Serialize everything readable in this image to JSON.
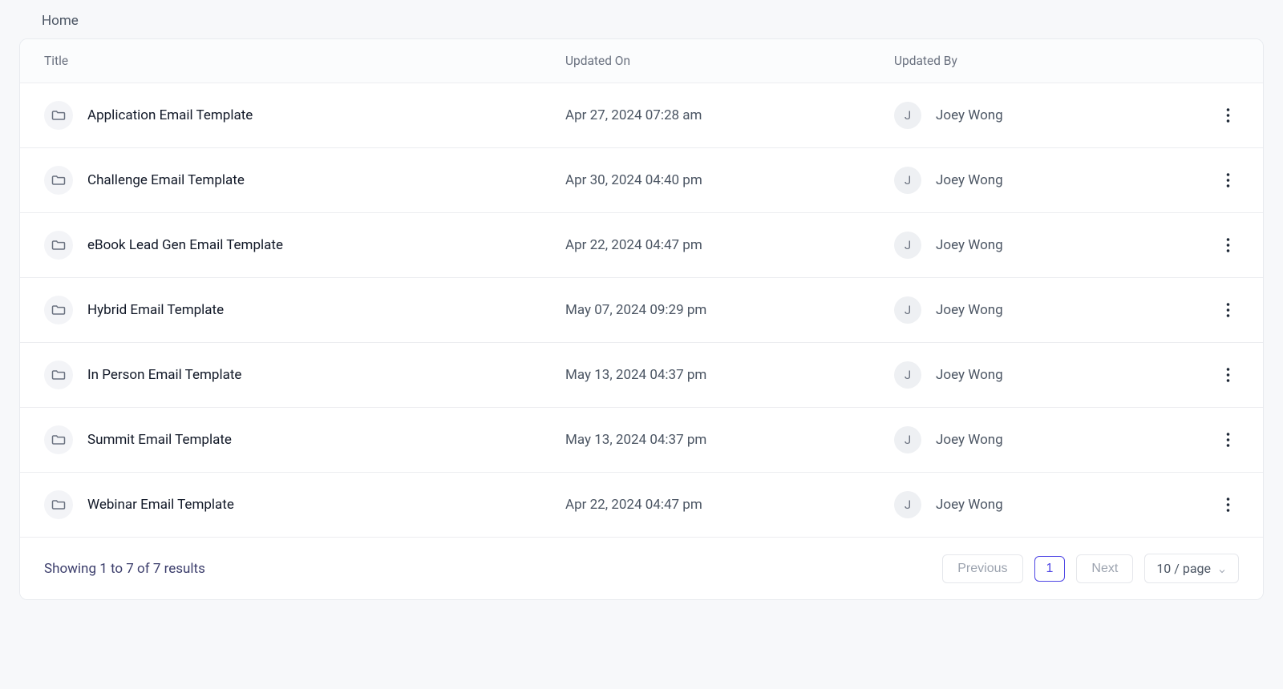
{
  "breadcrumb": {
    "home": "Home"
  },
  "columns": {
    "title": "Title",
    "updated_on": "Updated On",
    "updated_by": "Updated By"
  },
  "rows": [
    {
      "title": "Application Email Template",
      "updated_on": "Apr 27, 2024 07:28 am",
      "updated_by": "Joey Wong",
      "initial": "J"
    },
    {
      "title": "Challenge Email Template",
      "updated_on": "Apr 30, 2024 04:40 pm",
      "updated_by": "Joey Wong",
      "initial": "J"
    },
    {
      "title": "eBook Lead Gen Email Template",
      "updated_on": "Apr 22, 2024 04:47 pm",
      "updated_by": "Joey Wong",
      "initial": "J"
    },
    {
      "title": "Hybrid Email Template",
      "updated_on": "May 07, 2024 09:29 pm",
      "updated_by": "Joey Wong",
      "initial": "J"
    },
    {
      "title": "In Person Email Template",
      "updated_on": "May 13, 2024 04:37 pm",
      "updated_by": "Joey Wong",
      "initial": "J"
    },
    {
      "title": "Summit Email Template",
      "updated_on": "May 13, 2024 04:37 pm",
      "updated_by": "Joey Wong",
      "initial": "J"
    },
    {
      "title": "Webinar Email Template",
      "updated_on": "Apr 22, 2024 04:47 pm",
      "updated_by": "Joey Wong",
      "initial": "J"
    }
  ],
  "pagination": {
    "summary": "Showing 1 to 7 of 7 results",
    "previous": "Previous",
    "next": "Next",
    "current_page": "1",
    "page_size_label": "10 / page"
  }
}
